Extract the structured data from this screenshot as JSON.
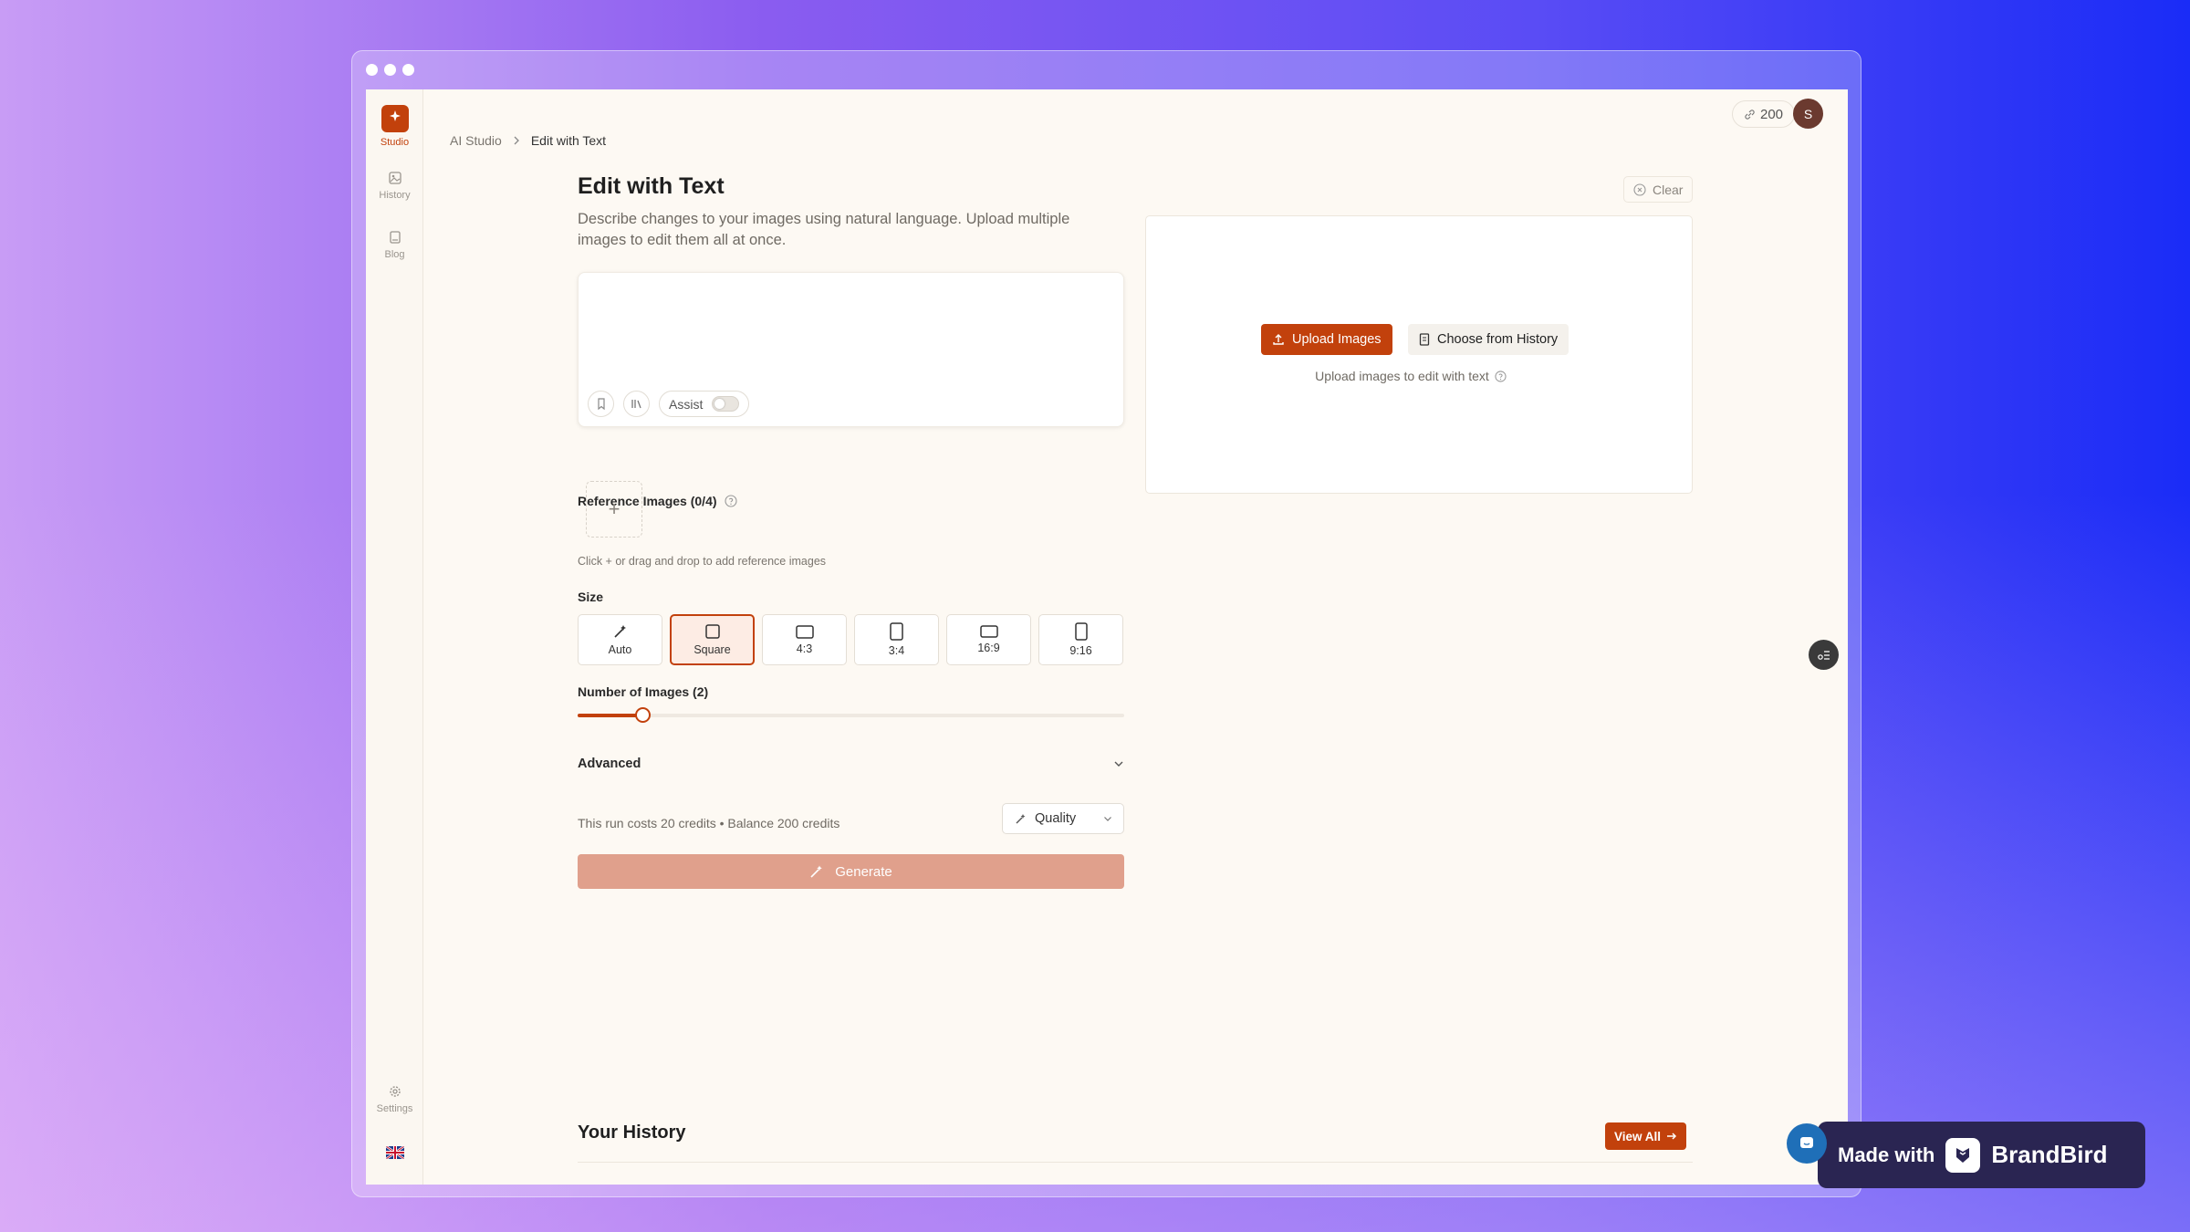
{
  "sidebar": {
    "items": [
      {
        "label": "Studio",
        "icon": "sparkle-icon"
      },
      {
        "label": "History",
        "icon": "image-icon"
      },
      {
        "label": "Blog",
        "icon": "book-icon"
      },
      {
        "label": "Settings",
        "icon": "gear-icon"
      }
    ],
    "accent": "#c2410c"
  },
  "topbar": {
    "credits": "200",
    "avatar_initial": "S"
  },
  "breadcrumb": {
    "root": "AI Studio",
    "current": "Edit with Text"
  },
  "page": {
    "title": "Edit with Text",
    "description": "Describe changes to your images using natural language. Upload multiple images to edit them all at once."
  },
  "prompt": {
    "value": "",
    "placeholder": "",
    "assist_label": "Assist"
  },
  "reference": {
    "label": "Reference Images (0/4)",
    "hint": "Click + or drag and drop to add reference images"
  },
  "size": {
    "label": "Size",
    "options": [
      "Auto",
      "Square",
      "4:3",
      "3:4",
      "16:9",
      "9:16"
    ],
    "selected": "Square"
  },
  "num_images": {
    "label": "Number of Images (2)",
    "value": 2,
    "max": 16
  },
  "advanced": {
    "label": "Advanced"
  },
  "cost": {
    "text": "This run costs 20 credits • Balance 200 credits",
    "quality_label": "Quality"
  },
  "generate": {
    "label": "Generate"
  },
  "upload": {
    "clear_label": "Clear",
    "upload_label": "Upload Images",
    "history_label": "Choose from History",
    "hint": "Upload images to edit with text"
  },
  "history": {
    "title": "Your History",
    "view_all": "View All"
  },
  "badge": {
    "made_with": "Made with",
    "brand": "BrandBird"
  }
}
